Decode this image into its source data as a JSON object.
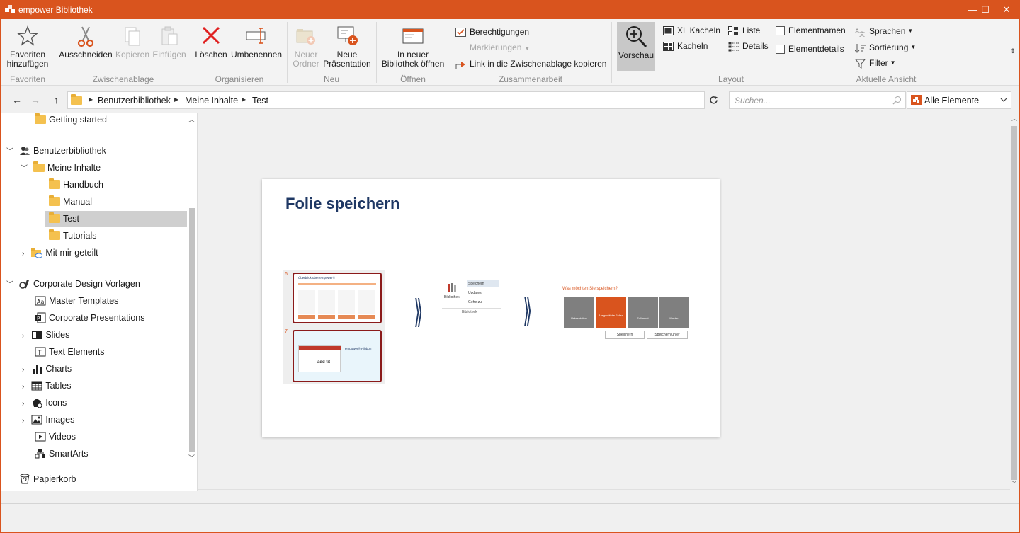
{
  "window": {
    "title": "empower Bibliothek",
    "accent_color": "#d9541e",
    "controls": {
      "minimize": "—",
      "maximize": "☐",
      "close": "✕"
    }
  },
  "ribbon": {
    "groups": {
      "favoriten": {
        "label": "Favoriten",
        "add": {
          "label_line1": "Favoriten",
          "label_line2": "hinzufügen",
          "icon": "star-icon"
        }
      },
      "zwischenablage": {
        "label": "Zwischenablage",
        "cut": "Ausschneiden",
        "copy": "Kopieren",
        "paste": "Einfügen"
      },
      "organisieren": {
        "label": "Organisieren",
        "delete": "Löschen",
        "rename": "Umbenennen"
      },
      "neu": {
        "label": "Neu",
        "new_folder_line1": "Neuer",
        "new_folder_line2": "Ordner",
        "new_presentation_line1": "Neue",
        "new_presentation_line2": "Präsentation"
      },
      "oeffnen": {
        "label": "Öffnen",
        "open_new_line1": "In neuer",
        "open_new_line2": "Bibliothek öffnen"
      },
      "zusammenarbeit": {
        "label": "Zusammenarbeit",
        "permissions": "Berechtigungen",
        "markings": "Markierungen",
        "copy_link": "Link in die Zwischenablage kopieren"
      },
      "layout": {
        "label": "Layout",
        "preview": "Vorschau",
        "xl_tiles": "XL Kacheln",
        "tiles": "Kacheln",
        "list": "Liste",
        "details": "Details",
        "element_names": "Elementnamen",
        "element_details": "Elementdetails"
      },
      "ansicht": {
        "label": "Aktuelle Ansicht",
        "languages": "Sprachen",
        "sorting": "Sortierung",
        "filter": "Filter"
      }
    }
  },
  "navbar": {
    "breadcrumb": [
      "Benutzerbibliothek",
      "Meine Inhalte",
      "Test"
    ],
    "search_placeholder": "Suchen...",
    "filter_value": "Alle Elemente"
  },
  "sidebar": {
    "getting_started": "Getting started",
    "user_library": "Benutzerbibliothek",
    "my_content": "Meine Inhalte",
    "folders": [
      "Handbuch",
      "Manual",
      "Test",
      "Tutorials"
    ],
    "shared": "Mit mir geteilt",
    "corporate": "Corporate Design Vorlagen",
    "corporate_items": [
      "Master Templates",
      "Corporate Presentations",
      "Slides",
      "Text Elements",
      "Charts",
      "Tables",
      "Icons",
      "Images",
      "Videos",
      "SmartArts"
    ],
    "trash": "Papierkorb"
  },
  "preview": {
    "slide_title": "Folie speichern",
    "thumb_numbers": [
      "6",
      "7"
    ],
    "thumb1_title": "Überblick über empower®",
    "thumb2_title": "empower® Ribbon",
    "thumb2_text": "add tit",
    "menu_library": "Bibliothek",
    "menu_save": "Speichern",
    "menu_updates": "Updates",
    "menu_goto": "Gehe zu",
    "menu_group": "Bibliothek",
    "dialog_question": "Was möchten Sie speichern?",
    "dialog_options": [
      "Präsentation",
      "Ausgewählte Folien",
      "Folienset",
      "Master"
    ],
    "dialog_save": "Speichern",
    "dialog_save_as": "Speichern unter"
  }
}
